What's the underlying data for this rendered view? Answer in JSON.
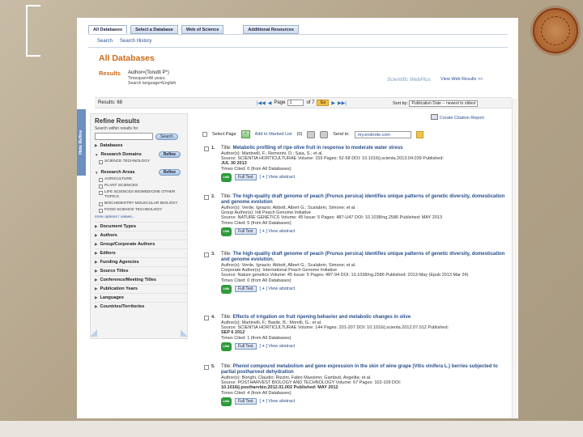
{
  "top_tabs": [
    "All Databases",
    "Select a Database",
    "Web of Science",
    "Additional Resources"
  ],
  "subnav": {
    "search": "Search",
    "history": "Search History"
  },
  "page_title": "All Databases",
  "results": {
    "label": "Results",
    "query": "Author=(Tonutti P*)",
    "timespan": "Timespan=All years.",
    "language": "Search language=English"
  },
  "swp": {
    "text": "Scientific WebPlus",
    "link": "View Web Results >>"
  },
  "result_count_label": "Results: 68",
  "pager": {
    "first": "|◀◀",
    "prev": "◀",
    "page_label": "Page",
    "page_value": "1",
    "of": "of 7",
    "go": "Go",
    "next": "▶",
    "last": "▶▶|"
  },
  "sort": {
    "label": "Sort by:",
    "value": "Publication Date -- newest to oldest"
  },
  "create_citation": "Create Citation Report",
  "refine": {
    "hide": "Hide Refine",
    "title": "Refine Results",
    "within": "Search within results for",
    "search_btn": "Search",
    "refine_btn": "Refine",
    "databases": "Databases",
    "research_domains": "Research Domains",
    "domain_opts": [
      "SCIENCE TECHNOLOGY"
    ],
    "research_areas": "Research Areas",
    "area_opts": [
      "AGRICULTURE",
      "PLANT SCIENCES",
      "LIFE SCIENCES BIOMEDICINE OTHER TOPICS",
      "BIOCHEMISTRY MOLECULAR BIOLOGY",
      "FOOD SCIENCE TECHNOLOGY"
    ],
    "more": "more options / values...",
    "facets": [
      "Document Types",
      "Authors",
      "Group/Corporate Authors",
      "Editors",
      "Funding Agencies",
      "Source Titles",
      "Conference/Meeting Titles",
      "Publication Years",
      "Languages",
      "Countries/Territories"
    ]
  },
  "toolbar": {
    "select_page": "Select Page",
    "add_marked": "Add to Marked List",
    "marked_count": "(0)",
    "send_to": "Send to:",
    "send_value": "my.endnote.com"
  },
  "records": [
    {
      "num": "1.",
      "title_label": "Title:",
      "title": "Metabolic profiling of ripe olive fruit in response to moderate water stress",
      "authors": "Author(s): Martinelli, F.; Remorini, D.; Saia, S.; et al.",
      "source": "Source: SCIENTIA HORTICULTURAE  Volume: 159  Pages: 52-58  DOI: 10.1016/j.scienta.2013.04.039  Published:",
      "published": "JUL 30 2013",
      "cited": "Times Cited: 0  (from All Databases)",
      "fulltext": "Full Text",
      "abstract": "View abstract"
    },
    {
      "num": "2.",
      "title_label": "Title:",
      "title": "The high-quality draft genome of peach (Prunus persica) identifies unique patterns of genetic diversity, domestication and genome evolution",
      "authors": "Author(s): Verde, Ignazio; Abbott, Albert G.; Scalabrin, Simone; et al.",
      "group": "Group Author(s): Intl Peach Genome Initiative",
      "source": "Source: NATURE GENETICS  Volume: 45  Issue: 5  Pages: 487-U47  DOI: 10.1038/ng.2586  Published: MAY 2013",
      "cited": "Times Cited: 5  (from All Databases)",
      "fulltext": "Full Text",
      "abstract": "View abstract"
    },
    {
      "num": "3.",
      "title_label": "Title:",
      "title": "The high-quality draft genome of peach (Prunus persica) identifies unique patterns of genetic diversity, domestication and genome evolution.",
      "authors": "Author(s): Verde, Ignazio; Abbott, Albert G.; Scalabrin, Simone; et al.",
      "group": "Corporate Author(s): International Peach Genome Initiative",
      "source": "Source: Nature genetics  Volume: 45  Issue: 5  Pages: 487-94  DOI: 10.1038/ng.2586  Published: 2013-May (Epub 2013 Mar 24)",
      "cited": "Times Cited: 0  (from All Databases)",
      "fulltext": "Full Text",
      "abstract": "View abstract"
    },
    {
      "num": "4.",
      "title_label": "Title:",
      "title": "Effects of irrigation on fruit ripening behavior and metabolic changes in olive",
      "authors": "Author(s): Martinelli, F.; Basile, B.; Morelli, G.; et al.",
      "source": "Source: SCIENTIA HORTICULTURAE  Volume: 144  Pages: 201-207  DOI: 10.1016/j.scienta.2012.07.012  Published:",
      "published": "SEP 6 2012",
      "cited": "Times Cited: 1  (from All Databases)",
      "fulltext": "Full Text",
      "abstract": "View abstract"
    },
    {
      "num": "5.",
      "title_label": "Title:",
      "title": "Phenol compound metabolism and gene expression in the skin of wine grape (Vitis vinifera L.) berries subjected to partial postharvest dehydration",
      "authors": "Author(s): Bonghi, Claudio; Rizzini, Fabio Massimo; Gambuti, Angelita; et al.",
      "source": "Source: POSTHARVEST BIOLOGY AND TECHNOLOGY  Volume: 67  Pages: 102-109  DOI:",
      "source2": "10.1016/j.postharvbio.2012.01.002  Published: MAY 2012",
      "cited": "Times Cited: 4  (from All Databases)",
      "fulltext": "Full Text",
      "abstract": "View abstract"
    }
  ]
}
